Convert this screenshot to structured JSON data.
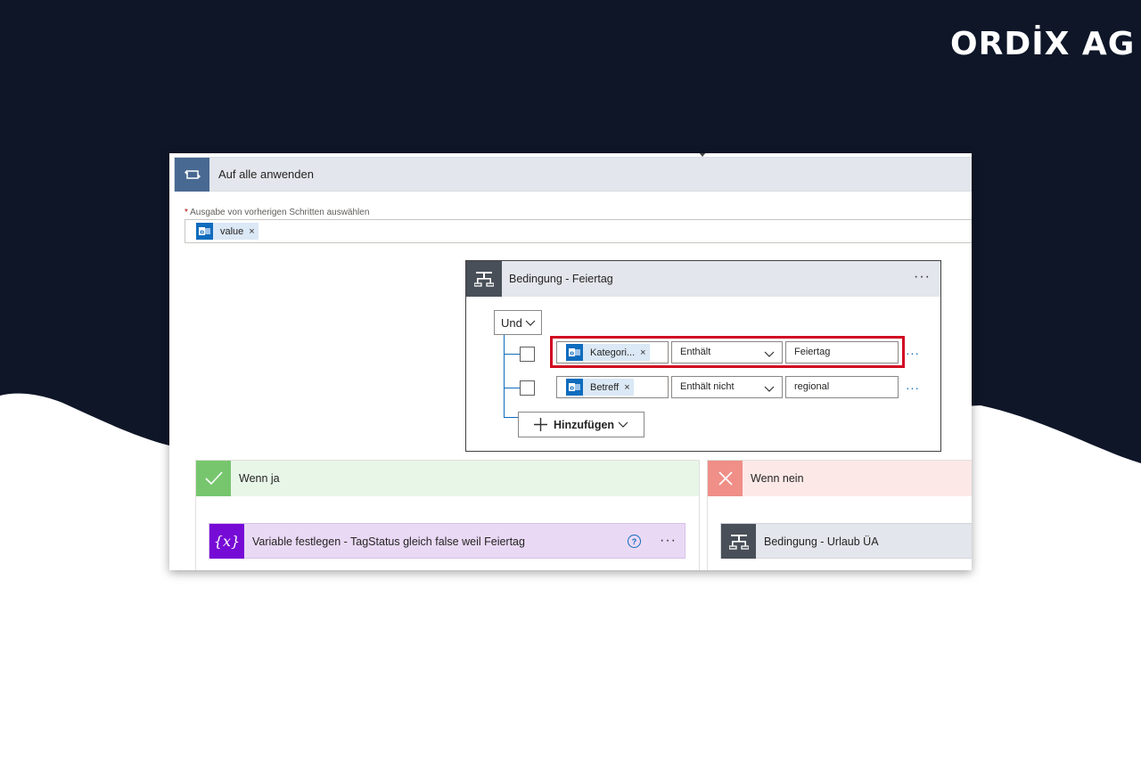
{
  "brand": {
    "logo": "ORDİX AG"
  },
  "apply_to_each": {
    "title": "Auf alle anwenden",
    "required_label": "Ausgabe von vorherigen Schritten auswählen",
    "required_marker": "*",
    "token": {
      "label": "value",
      "remove": "×",
      "icon": "outlook-icon"
    }
  },
  "condition": {
    "title": "Bedingung - Feiertag",
    "menu": "···",
    "group_operator": "Und",
    "rows": [
      {
        "field": "Kategori...",
        "field_remove": "×",
        "operator": "Enthält",
        "value": "Feiertag",
        "menu": "···",
        "highlighted": true
      },
      {
        "field": "Betreff",
        "field_remove": "×",
        "operator": "Enthält nicht",
        "value": "regional",
        "menu": "···",
        "highlighted": false
      }
    ],
    "add_button": "Hinzufügen"
  },
  "yes_branch": {
    "title": "Wenn ja",
    "action": {
      "title": "Variable festlegen - TagStatus gleich false weil Feiertag",
      "help": "?",
      "menu": "···",
      "icon_text": "{x}"
    }
  },
  "no_branch": {
    "title": "Wenn nein",
    "action": {
      "title": "Bedingung - Urlaub ÜA"
    }
  },
  "colors": {
    "navy_background": "#0e1628",
    "apply_icon": "#486991",
    "condition_icon": "#484f58",
    "yes_accent": "#77c66e",
    "no_accent": "#ef8f87",
    "variable_accent": "#770bd6",
    "highlight_border": "#d10a22",
    "link_blue": "#0f6cbd"
  }
}
